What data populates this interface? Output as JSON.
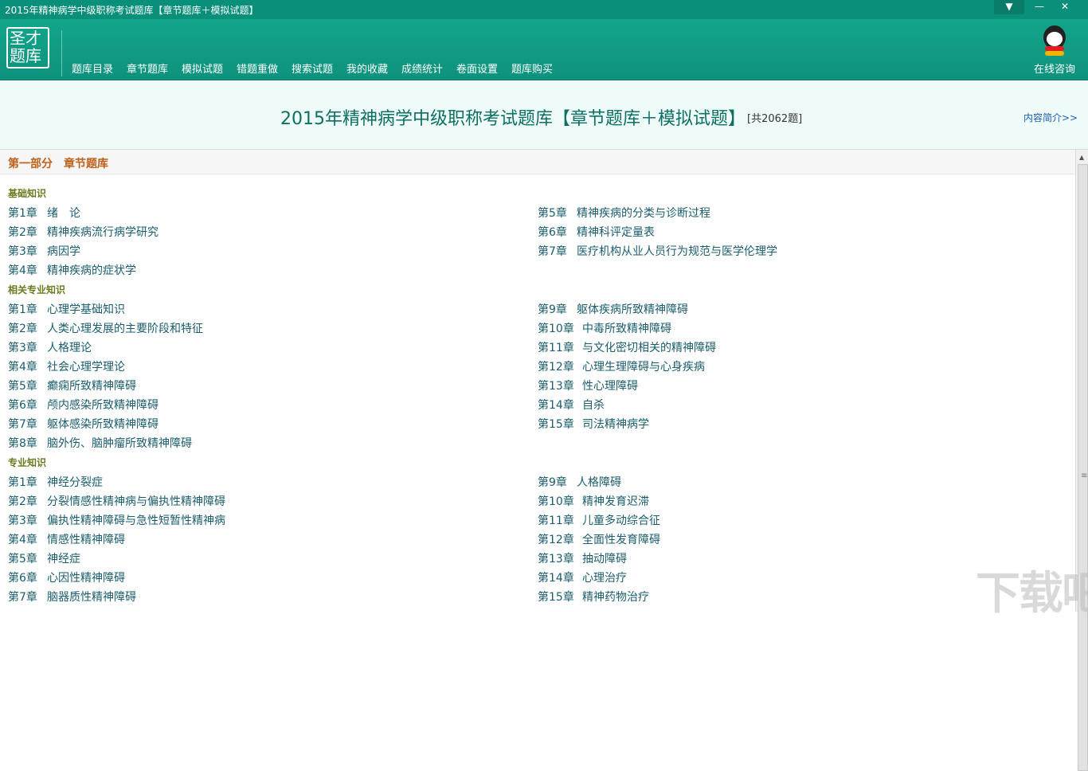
{
  "window": {
    "title": "2015年精神病学中级职称考试题库【章节题库＋模拟试题】",
    "buttons": [
      "▼",
      "—",
      "✕"
    ]
  },
  "logo": {
    "line1": "圣才",
    "line2": "题库"
  },
  "nav": [
    "题库目录",
    "章节题库",
    "模拟试题",
    "错题重做",
    "搜索试题",
    "我的收藏",
    "成绩统计",
    "卷面设置",
    "题库购买"
  ],
  "consult": "在线咨询",
  "banner": {
    "title": "2015年精神病学中级职称考试题库【章节题库＋模拟试题】",
    "count": "[共2062题]",
    "intro": "内容简介>>"
  },
  "section": "第一部分　章节题库",
  "groups": {
    "basic": {
      "label": "基础知识",
      "left": [
        {
          "num": "第1章",
          "name": "绪　论"
        },
        {
          "num": "第2章",
          "name": "精神疾病流行病学研究"
        },
        {
          "num": "第3章",
          "name": "病因学"
        },
        {
          "num": "第4章",
          "name": "精神疾病的症状学"
        }
      ],
      "right": [
        {
          "num": "第5章",
          "name": "精神疾病的分类与诊断过程"
        },
        {
          "num": "第6章",
          "name": "精神科评定量表"
        },
        {
          "num": "第7章",
          "name": "医疗机构从业人员行为规范与医学伦理学"
        }
      ]
    },
    "related": {
      "label": "相关专业知识",
      "left": [
        {
          "num": "第1章",
          "name": "心理学基础知识"
        },
        {
          "num": "第2章",
          "name": "人类心理发展的主要阶段和特征"
        },
        {
          "num": "第3章",
          "name": "人格理论"
        },
        {
          "num": "第4章",
          "name": "社会心理学理论"
        },
        {
          "num": "第5章",
          "name": "癫痫所致精神障碍"
        },
        {
          "num": "第6章",
          "name": "颅内感染所致精神障碍"
        },
        {
          "num": "第7章",
          "name": "躯体感染所致精神障碍"
        },
        {
          "num": "第8章",
          "name": "脑外伤、脑肿瘤所致精神障碍"
        }
      ],
      "right": [
        {
          "num": "第9章",
          "name": "躯体疾病所致精神障碍"
        },
        {
          "num": "第10章",
          "name": "中毒所致精神障碍"
        },
        {
          "num": "第11章",
          "name": "与文化密切相关的精神障碍"
        },
        {
          "num": "第12章",
          "name": "心理生理障碍与心身疾病"
        },
        {
          "num": "第13章",
          "name": "性心理障碍"
        },
        {
          "num": "第14章",
          "name": "自杀"
        },
        {
          "num": "第15章",
          "name": "司法精神病学"
        }
      ]
    },
    "professional": {
      "label": "专业知识",
      "left": [
        {
          "num": "第1章",
          "name": "神经分裂症"
        },
        {
          "num": "第2章",
          "name": "分裂情感性精神病与偏执性精神障碍"
        },
        {
          "num": "第3章",
          "name": "偏执性精神障碍与急性短暂性精神病"
        },
        {
          "num": "第4章",
          "name": "情感性精神障碍"
        },
        {
          "num": "第5章",
          "name": "神经症"
        },
        {
          "num": "第6章",
          "name": "心因性精神障碍"
        },
        {
          "num": "第7章",
          "name": "脑器质性精神障碍"
        }
      ],
      "right": [
        {
          "num": "第9章",
          "name": "人格障碍"
        },
        {
          "num": "第10章",
          "name": "精神发育迟滞"
        },
        {
          "num": "第11章",
          "name": "儿童多动综合征"
        },
        {
          "num": "第12章",
          "name": "全面性发育障碍"
        },
        {
          "num": "第13章",
          "name": "抽动障碍"
        },
        {
          "num": "第14章",
          "name": "心理治疗"
        },
        {
          "num": "第15章",
          "name": "精神药物治疗"
        }
      ]
    }
  },
  "watermark": "下载吧"
}
